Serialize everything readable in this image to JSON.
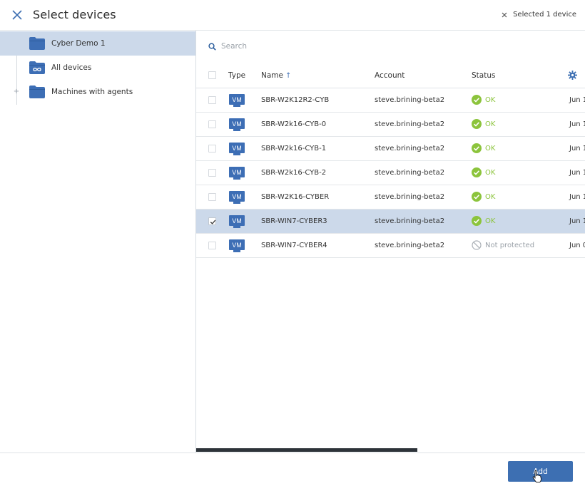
{
  "header": {
    "title": "Select devices",
    "selected_text": "Selected 1 device"
  },
  "tree": {
    "items": [
      {
        "label": "Cyber Demo 1",
        "selected": true,
        "toggle": ""
      },
      {
        "label": "All devices",
        "selected": false,
        "toggle": ""
      },
      {
        "label": "Machines with agents",
        "selected": false,
        "toggle": "+"
      }
    ]
  },
  "search": {
    "placeholder": "Search",
    "value": ""
  },
  "table": {
    "headers": {
      "type": "Type",
      "name": "Name",
      "sort_arrow": "↑",
      "account": "Account",
      "status": "Status"
    },
    "rows": [
      {
        "type": "VM",
        "name": "SBR-W2K12R2-CYB",
        "account": "steve.brining-beta2",
        "status": "OK",
        "status_kind": "ok",
        "date": "Jun 1",
        "checked": false,
        "selected": false
      },
      {
        "type": "VM",
        "name": "SBR-W2k16-CYB-0",
        "account": "steve.brining-beta2",
        "status": "OK",
        "status_kind": "ok",
        "date": "Jun 1",
        "checked": false,
        "selected": false
      },
      {
        "type": "VM",
        "name": "SBR-W2k16-CYB-1",
        "account": "steve.brining-beta2",
        "status": "OK",
        "status_kind": "ok",
        "date": "Jun 1",
        "checked": false,
        "selected": false
      },
      {
        "type": "VM",
        "name": "SBR-W2k16-CYB-2",
        "account": "steve.brining-beta2",
        "status": "OK",
        "status_kind": "ok",
        "date": "Jun 1",
        "checked": false,
        "selected": false
      },
      {
        "type": "VM",
        "name": "SBR-W2K16-CYBER",
        "account": "steve.brining-beta2",
        "status": "OK",
        "status_kind": "ok",
        "date": "Jun 1",
        "checked": false,
        "selected": false
      },
      {
        "type": "VM",
        "name": "SBR-WIN7-CYBER3",
        "account": "steve.brining-beta2",
        "status": "OK",
        "status_kind": "ok",
        "date": "Jun 1",
        "checked": true,
        "selected": true
      },
      {
        "type": "VM",
        "name": "SBR-WIN7-CYBER4",
        "account": "steve.brining-beta2",
        "status": "Not protected",
        "status_kind": "not-protected",
        "date": "Jun 0",
        "checked": false,
        "selected": false
      }
    ]
  },
  "footer": {
    "add_label": "Add"
  },
  "colors": {
    "accent": "#3d6fb2",
    "selected_row": "#ccd9ea",
    "ok": "#8cc43c",
    "not_protected": "#9aa1a8",
    "vm_badge": "#3d6eb5"
  },
  "icons": {
    "close": "close-icon",
    "deselect": "deselect-icon",
    "folder": "folder-icon",
    "all_devices": "all-devices-icon",
    "search": "search-icon",
    "settings": "gear-icon",
    "ok": "check-circle-icon",
    "not_protected": "not-protected-icon",
    "vm": "vm-icon"
  }
}
